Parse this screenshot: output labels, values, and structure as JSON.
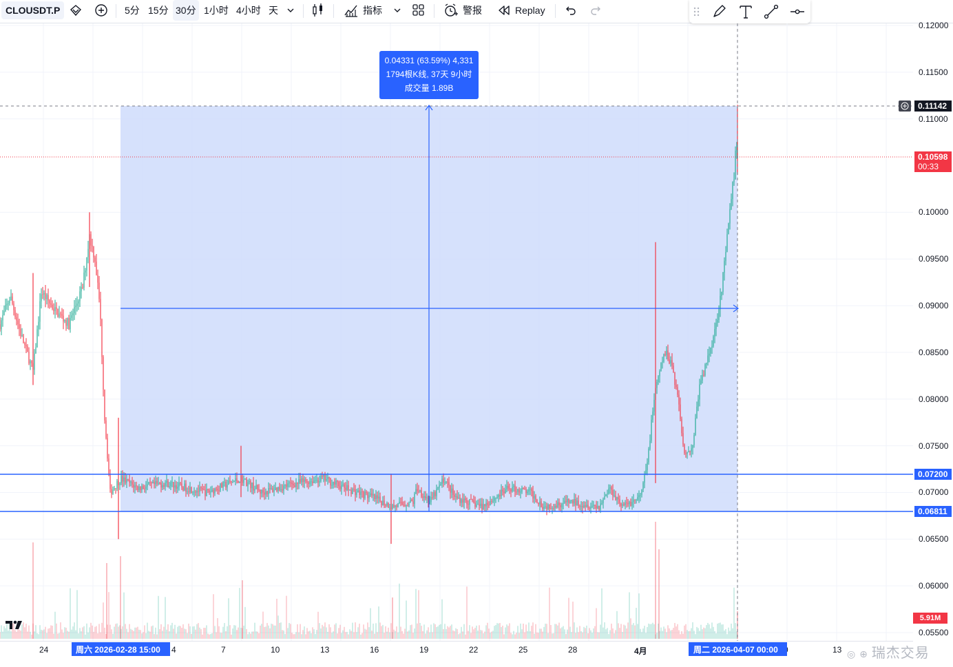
{
  "toolbar": {
    "symbol": "CLOUSDT.P",
    "intervals": [
      "5分",
      "15分",
      "30分",
      "1小时",
      "4小时",
      "天"
    ],
    "active_interval": "30分",
    "indicators_label": "指标",
    "alert_label": "警报",
    "replay_label": "Replay"
  },
  "drawing_tools": [
    "brush-icon",
    "text-icon",
    "trend-line-icon",
    "horizontal-ray-icon"
  ],
  "measure": {
    "line1": "0.04331 (63.59%) 4,331",
    "line2": "1794根K线, 37天 9小时",
    "line3": "成交量 1.89B"
  },
  "price_axis": {
    "ticks": [
      "0.12000",
      "0.11500",
      "0.11000",
      "0.10000",
      "0.09500",
      "0.09000",
      "0.08500",
      "0.08000",
      "0.07500",
      "0.07000",
      "0.06500",
      "0.06000",
      "0.05500"
    ],
    "measure_top": "0.11142",
    "last_price": "0.10598",
    "countdown": "00:33",
    "level_upper": "0.07200",
    "level_lower": "0.06811",
    "volume_tag": "5.91M"
  },
  "time_axis": {
    "ticks": [
      "24",
      "4",
      "7",
      "10",
      "13",
      "16",
      "19",
      "22",
      "25",
      "28",
      "4月",
      "0",
      "13"
    ],
    "start_tag": "周六 2026-02-28   15:00",
    "end_tag": "周二 2026-04-07   00:00"
  },
  "watermark": "瑞杰交易",
  "colors": {
    "up": "#22ab94",
    "down": "#f23645",
    "accent": "#2962ff",
    "measure_fill": "#cfdcfb"
  }
}
